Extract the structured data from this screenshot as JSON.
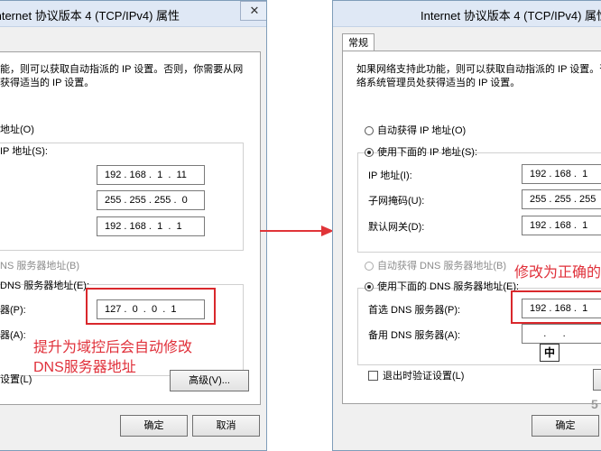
{
  "left_window": {
    "title": "Internet 协议版本 4 (TCP/IPv4) 属性",
    "close": "✕",
    "intro_line1": "能，则可以获取自动指派的 IP 设置。否则，你需要从网",
    "intro_line2": "获得适当的 IP 设置。",
    "auto_ip_label": "地址(O)",
    "use_ip_label": "IP 地址(S):",
    "ip_address": "192 . 168 .  1  .  11",
    "subnet_mask": "255 . 255 . 255 .  0",
    "gateway": "192 . 168 .  1  .  1",
    "auto_dns_label": "NS 服务器地址(B)",
    "use_dns_label": "DNS 服务器地址(E):",
    "preferred_dns_label": "器(P):",
    "preferred_dns": "127 .  0  .  0  .  1",
    "alternate_dns_label": "器(A):",
    "validate_label": "设置(L)",
    "advanced_button": "高级(V)...",
    "ok_button": "确定",
    "cancel_button": "取消",
    "annotation_line1": "提升为域控后会自动修改",
    "annotation_line2": "DNS服务器地址"
  },
  "right_window": {
    "title": "Internet 协议版本 4 (TCP/IPv4) 属性",
    "tab_general": "常规",
    "intro_line1": "如果网络支持此功能，则可以获取自动指派的 IP 设置。否则，",
    "intro_line2": "络系统管理员处获得适当的 IP 设置。",
    "auto_ip_label": "自动获得 IP 地址(O)",
    "use_ip_label": "使用下面的 IP 地址(S):",
    "ip_address_label": "IP 地址(I):",
    "ip_address": "192 . 168 .  1",
    "subnet_label": "子网掩码(U):",
    "subnet_mask": "255 . 255 . 255",
    "gateway_label": "默认网关(D):",
    "gateway": "192 . 168 .  1",
    "auto_dns_label": "自动获得 DNS 服务器地址(B)",
    "use_dns_label": "使用下面的 DNS 服务器地址(E):",
    "preferred_dns_label": "首选 DNS 服务器(P):",
    "preferred_dns": "192 . 168 .  1",
    "alternate_dns_label": "备用 DNS 服务器(A):",
    "alternate_dns": "     .      .",
    "validate_label": "退出时验证设置(L)",
    "ok_button": "确定",
    "ime_indicator": "中",
    "annotation": "修改为正确的",
    "watermark": "5"
  }
}
